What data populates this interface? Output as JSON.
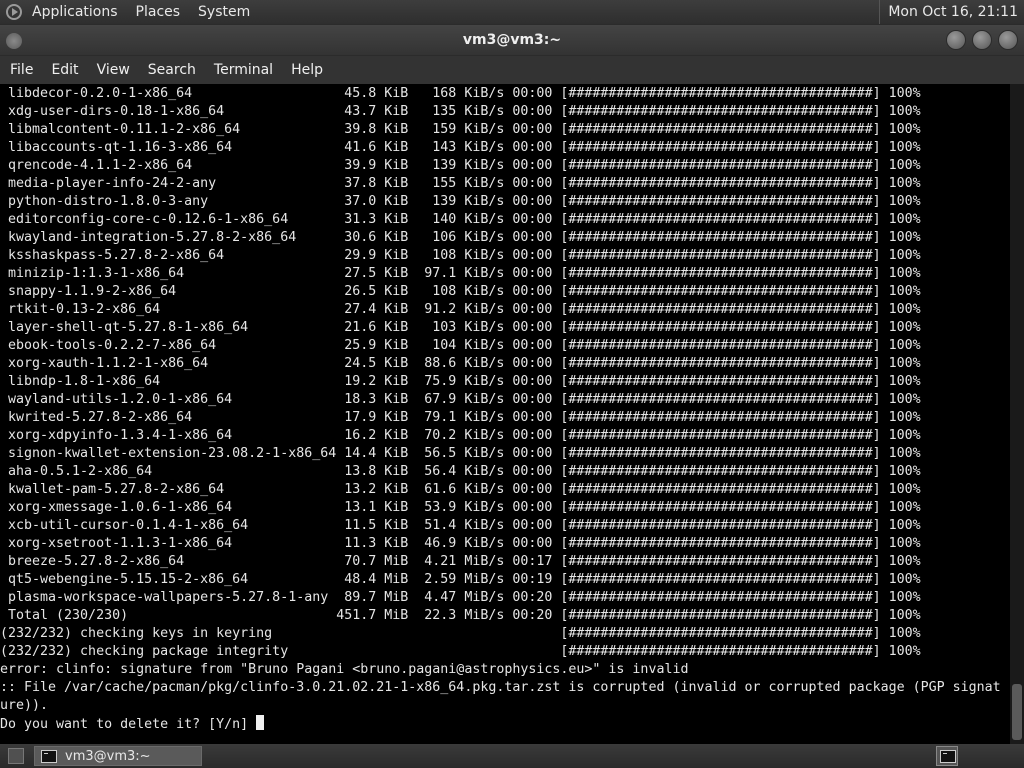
{
  "top_panel": {
    "menus": [
      "Applications",
      "Places",
      "System"
    ],
    "clock": "Mon Oct 16, 21:11"
  },
  "window": {
    "title": "vm3@vm3:~"
  },
  "menubar": [
    "File",
    "Edit",
    "View",
    "Search",
    "Terminal",
    "Help"
  ],
  "terminal": {
    "lines": [
      " libdecor-0.2.0-1-x86_64                   45.8 KiB   168 KiB/s 00:00 [######################################] 100%",
      " xdg-user-dirs-0.18-1-x86_64               43.7 KiB   135 KiB/s 00:00 [######################################] 100%",
      " libmalcontent-0.11.1-2-x86_64             39.8 KiB   159 KiB/s 00:00 [######################################] 100%",
      " libaccounts-qt-1.16-3-x86_64              41.6 KiB   143 KiB/s 00:00 [######################################] 100%",
      " qrencode-4.1.1-2-x86_64                   39.9 KiB   139 KiB/s 00:00 [######################################] 100%",
      " media-player-info-24-2-any                37.8 KiB   155 KiB/s 00:00 [######################################] 100%",
      " python-distro-1.8.0-3-any                 37.0 KiB   139 KiB/s 00:00 [######################################] 100%",
      " editorconfig-core-c-0.12.6-1-x86_64       31.3 KiB   140 KiB/s 00:00 [######################################] 100%",
      " kwayland-integration-5.27.8-2-x86_64      30.6 KiB   106 KiB/s 00:00 [######################################] 100%",
      " ksshaskpass-5.27.8-2-x86_64               29.9 KiB   108 KiB/s 00:00 [######################################] 100%",
      " minizip-1:1.3-1-x86_64                    27.5 KiB  97.1 KiB/s 00:00 [######################################] 100%",
      " snappy-1.1.9-2-x86_64                     26.5 KiB   108 KiB/s 00:00 [######################################] 100%",
      " rtkit-0.13-2-x86_64                       27.4 KiB  91.2 KiB/s 00:00 [######################################] 100%",
      " layer-shell-qt-5.27.8-1-x86_64            21.6 KiB   103 KiB/s 00:00 [######################################] 100%",
      " ebook-tools-0.2.2-7-x86_64                25.9 KiB   104 KiB/s 00:00 [######################################] 100%",
      " xorg-xauth-1.1.2-1-x86_64                 24.5 KiB  88.6 KiB/s 00:00 [######################################] 100%",
      " libndp-1.8-1-x86_64                       19.2 KiB  75.9 KiB/s 00:00 [######################################] 100%",
      " wayland-utils-1.2.0-1-x86_64              18.3 KiB  67.9 KiB/s 00:00 [######################################] 100%",
      " kwrited-5.27.8-2-x86_64                   17.9 KiB  79.1 KiB/s 00:00 [######################################] 100%",
      " xorg-xdpyinfo-1.3.4-1-x86_64              16.2 KiB  70.2 KiB/s 00:00 [######################################] 100%",
      " signon-kwallet-extension-23.08.2-1-x86_64 14.4 KiB  56.5 KiB/s 00:00 [######################################] 100%",
      " aha-0.5.1-2-x86_64                        13.8 KiB  56.4 KiB/s 00:00 [######################################] 100%",
      " kwallet-pam-5.27.8-2-x86_64               13.2 KiB  61.6 KiB/s 00:00 [######################################] 100%",
      " xorg-xmessage-1.0.6-1-x86_64              13.1 KiB  53.9 KiB/s 00:00 [######################################] 100%",
      " xcb-util-cursor-0.1.4-1-x86_64            11.5 KiB  51.4 KiB/s 00:00 [######################################] 100%",
      " xorg-xsetroot-1.1.3-1-x86_64              11.3 KiB  46.9 KiB/s 00:00 [######################################] 100%",
      " breeze-5.27.8-2-x86_64                    70.7 MiB  4.21 MiB/s 00:17 [######################################] 100%",
      " qt5-webengine-5.15.15-2-x86_64            48.4 MiB  2.59 MiB/s 00:19 [######################################] 100%",
      " plasma-workspace-wallpapers-5.27.8-1-any  89.7 MiB  4.47 MiB/s 00:20 [######################################] 100%",
      " Total (230/230)                          451.7 MiB  22.3 MiB/s 00:20 [######################################] 100%",
      "(232/232) checking keys in keyring                                    [######################################] 100%",
      "(232/232) checking package integrity                                  [######################################] 100%",
      "error: clinfo: signature from \"Bruno Pagani <bruno.pagani@astrophysics.eu>\" is invalid",
      ":: File /var/cache/pacman/pkg/clinfo-3.0.21.02.21-1-x86_64.pkg.tar.zst is corrupted (invalid or corrupted package (PGP signat",
      "ure))."
    ],
    "prompt": "Do you want to delete it? [Y/n] "
  },
  "taskbar": {
    "task_label": "vm3@vm3:~"
  }
}
